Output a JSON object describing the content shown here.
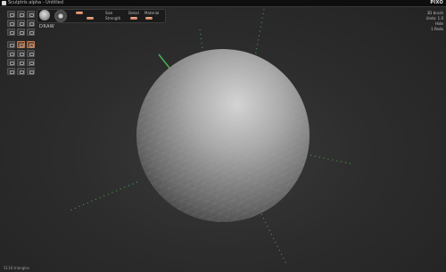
{
  "window": {
    "title": "Sculptris alpha - Untitled",
    "brand": "PIXO"
  },
  "toolbar": {
    "active_tool_label": "DRAW",
    "params": [
      {
        "label": "Size"
      },
      {
        "label": "Strength"
      },
      {
        "label": "Detail"
      },
      {
        "label": "Material"
      }
    ]
  },
  "left_panel": {
    "groups": [
      {
        "name": "brushes",
        "count": 9
      },
      {
        "name": "modes",
        "count": 6
      },
      {
        "name": "tools",
        "count": 6
      }
    ]
  },
  "info": {
    "lines": [
      "3D brush",
      "Undo: 1.0",
      "Hide",
      "1 Redo"
    ]
  },
  "status": {
    "triangles": "5116 triangles"
  },
  "colors": {
    "accent": "#c8704a",
    "background": "#2a2a2a",
    "sphere": "#9a9a9a",
    "guides": "#4caf50"
  }
}
